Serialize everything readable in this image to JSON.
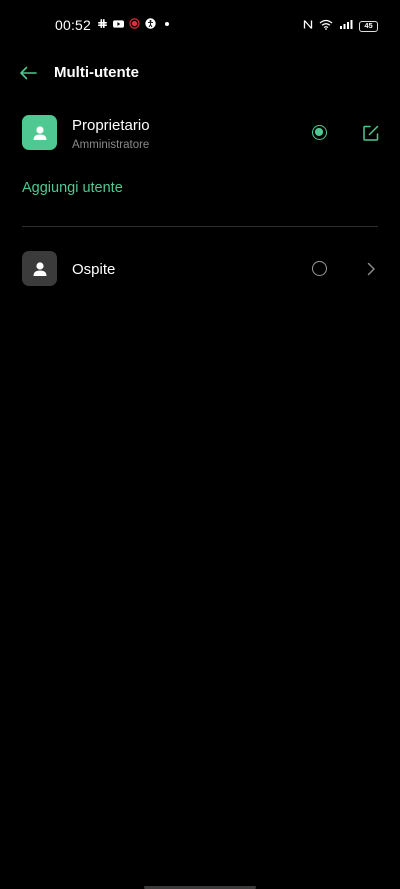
{
  "status_bar": {
    "time": "00:52",
    "battery": "45",
    "left_icons": [
      "slack-icon",
      "youtube-icon",
      "record-icon",
      "accessibility-icon",
      "dot-icon"
    ],
    "right_icons": [
      "nfc-icon",
      "wifi-icon",
      "signal-icon",
      "battery-icon"
    ]
  },
  "header": {
    "title": "Multi-utente",
    "back_icon": "arrow-left-icon"
  },
  "users": {
    "owner": {
      "name": "Proprietario",
      "role": "Amministratore",
      "selected": true
    },
    "guest": {
      "name": "Ospite",
      "selected": false
    }
  },
  "add_user_label": "Aggiungi utente",
  "colors": {
    "accent": "#4fc891",
    "background": "#000000",
    "guest_avatar": "#3b3b3b",
    "secondary_text": "#8a8a8a",
    "divider": "#2c2c2c"
  }
}
